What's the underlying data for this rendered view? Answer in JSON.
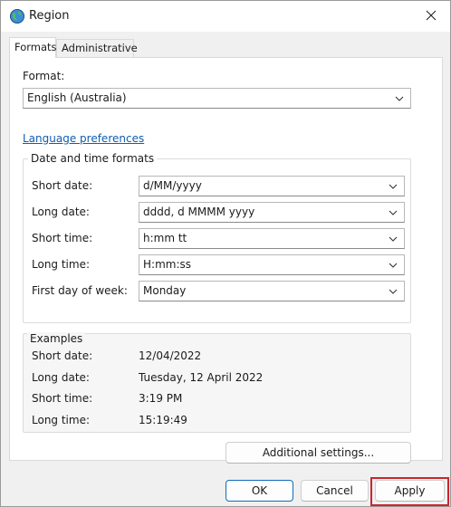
{
  "window": {
    "title": "Region"
  },
  "tabs": [
    {
      "label": "Formats",
      "active": true
    },
    {
      "label": "Administrative",
      "active": false
    }
  ],
  "format": {
    "label": "Format:",
    "value": "English (Australia)"
  },
  "language_link": "Language preferences",
  "datetime": {
    "title": "Date and time formats",
    "rows": [
      {
        "label": "Short date:",
        "value": "d/MM/yyyy"
      },
      {
        "label": "Long date:",
        "value": "dddd, d MMMM yyyy"
      },
      {
        "label": "Short time:",
        "value": "h:mm tt"
      },
      {
        "label": "Long time:",
        "value": "H:mm:ss"
      },
      {
        "label": "First day of week:",
        "value": "Monday"
      }
    ]
  },
  "examples": {
    "title": "Examples",
    "rows": [
      {
        "label": "Short date:",
        "value": "12/04/2022"
      },
      {
        "label": "Long date:",
        "value": "Tuesday, 12 April 2022"
      },
      {
        "label": "Short time:",
        "value": "3:19 PM"
      },
      {
        "label": "Long time:",
        "value": "15:19:49"
      }
    ]
  },
  "buttons": {
    "additional": "Additional settings...",
    "ok": "OK",
    "cancel": "Cancel",
    "apply": "Apply"
  },
  "colors": {
    "link": "#0f5eb0",
    "highlight": "#c8262f"
  },
  "icons": {
    "title": "globe-icon",
    "close": "close-icon",
    "dropdown": "chevron-down-icon"
  }
}
